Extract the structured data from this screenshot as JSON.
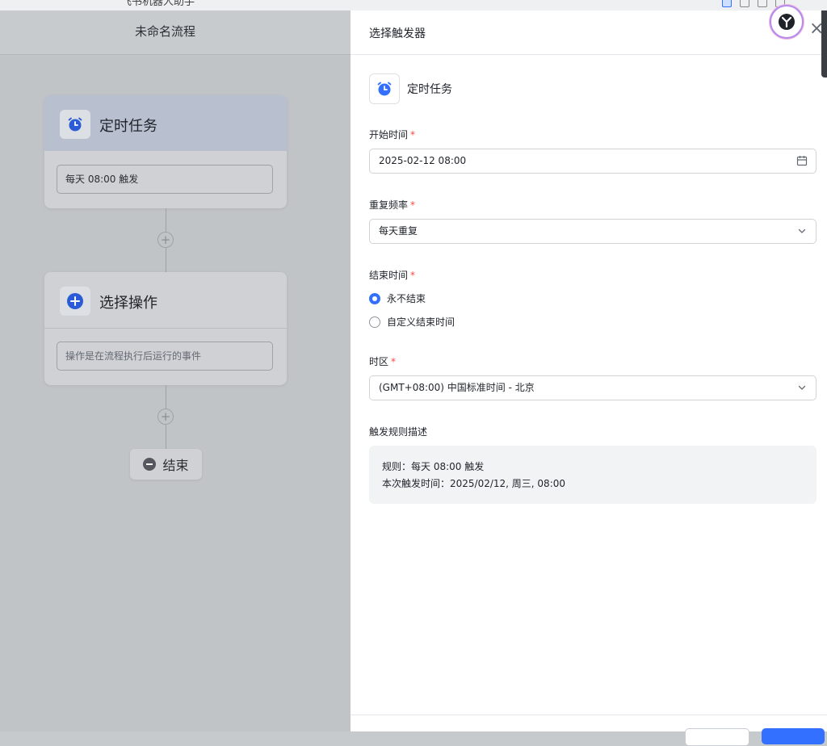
{
  "window": {
    "app_title": "飞书机器人助手"
  },
  "canvas": {
    "title": "未命名流程",
    "trigger_card": {
      "title": "定时任务",
      "summary": "每天 08:00 触发"
    },
    "action_card": {
      "title": "选择操作",
      "placeholder": "操作是在流程执行后运行的事件"
    },
    "end_node": {
      "label": "结束"
    }
  },
  "panel": {
    "title": "选择触发器",
    "trigger_type": "定时任务",
    "start_time": {
      "label": "开始时间",
      "required_mark": "*",
      "value": "2025-02-12 08:00"
    },
    "frequency": {
      "label": "重复频率",
      "required_mark": "*",
      "value": "每天重复"
    },
    "end_time": {
      "label": "结束时间",
      "required_mark": "*",
      "options": [
        {
          "label": "永不结束",
          "selected": true
        },
        {
          "label": "自定义结束时间",
          "selected": false
        }
      ]
    },
    "timezone": {
      "label": "时区",
      "required_mark": "*",
      "value": "(GMT+08:00) 中国标准时间 - 北京"
    },
    "rule_description": {
      "label": "触发规则描述",
      "rule": "规则：每天 08:00 触发",
      "next_trigger": "本次触发时间：2025/02/12, 周三, 08:00"
    }
  },
  "colors": {
    "accent": "#3370ff",
    "required": "#f54a45",
    "trigger_card_header": "#b8c0d0"
  },
  "icons": [
    "alarm-clock-icon",
    "plus-icon",
    "add-circle-icon",
    "minus-circle-icon",
    "calendar-icon",
    "chevron-down-icon",
    "close-icon",
    "assistant-logo-icon"
  ]
}
